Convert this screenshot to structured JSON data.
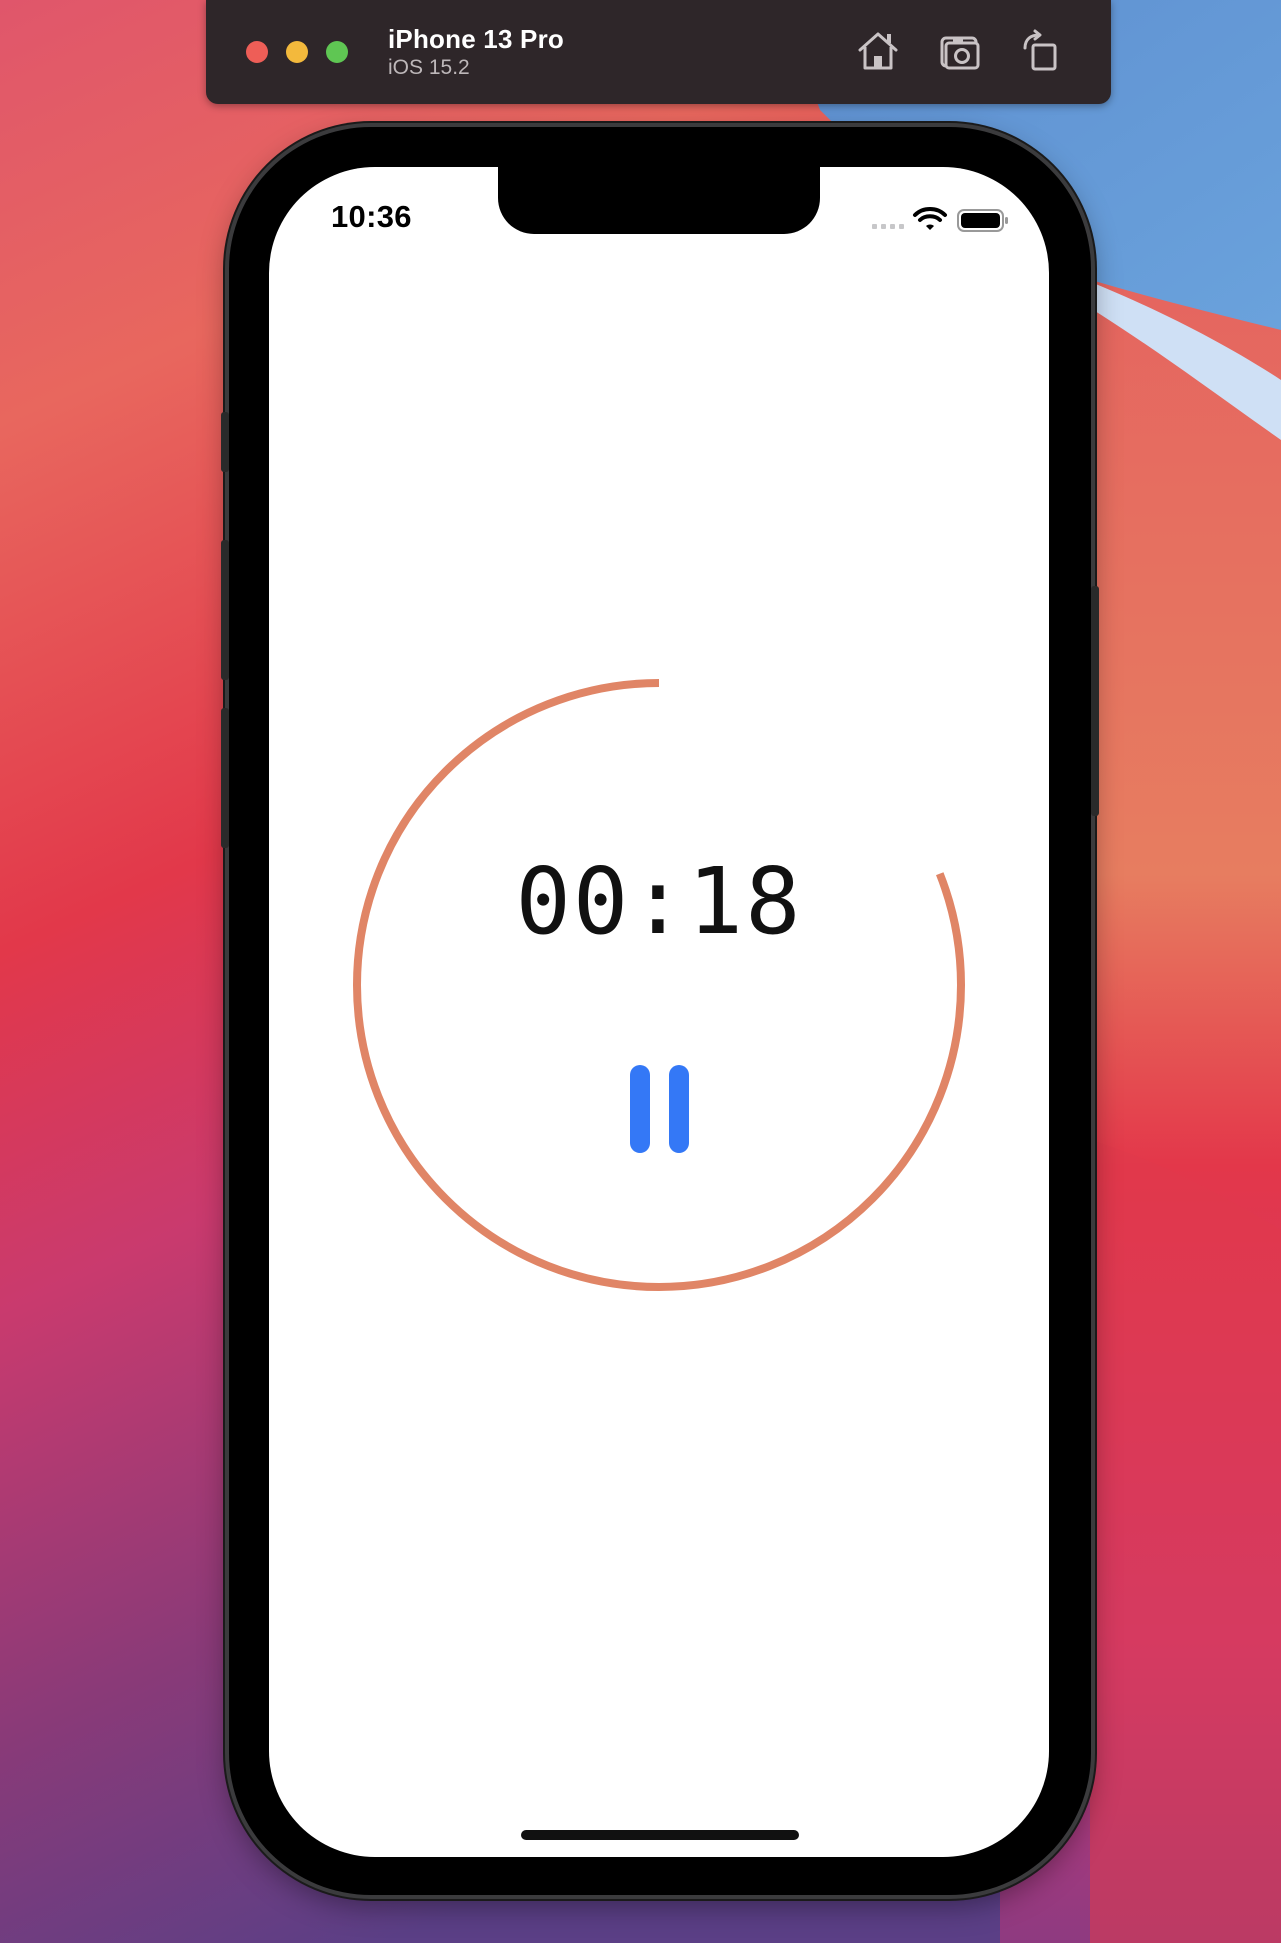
{
  "simulator": {
    "device_name": "iPhone 13 Pro",
    "os_version": "iOS 15.2",
    "toolbar_icons": [
      "home-icon",
      "screenshot-icon",
      "rotate-icon"
    ]
  },
  "status_bar": {
    "time": "10:36",
    "icons": [
      "cellular-icon",
      "wifi-icon",
      "battery-icon"
    ]
  },
  "timer": {
    "display": "00:18",
    "progress_remaining": 0.81,
    "ring_color": "#e08566",
    "pause_icon": "pause-icon",
    "pause_color": "#3478f6"
  },
  "colors": {
    "window_chrome": "#2e2629",
    "close": "#ee5e57",
    "minimize": "#f3b93c",
    "maximize": "#5fc653"
  }
}
